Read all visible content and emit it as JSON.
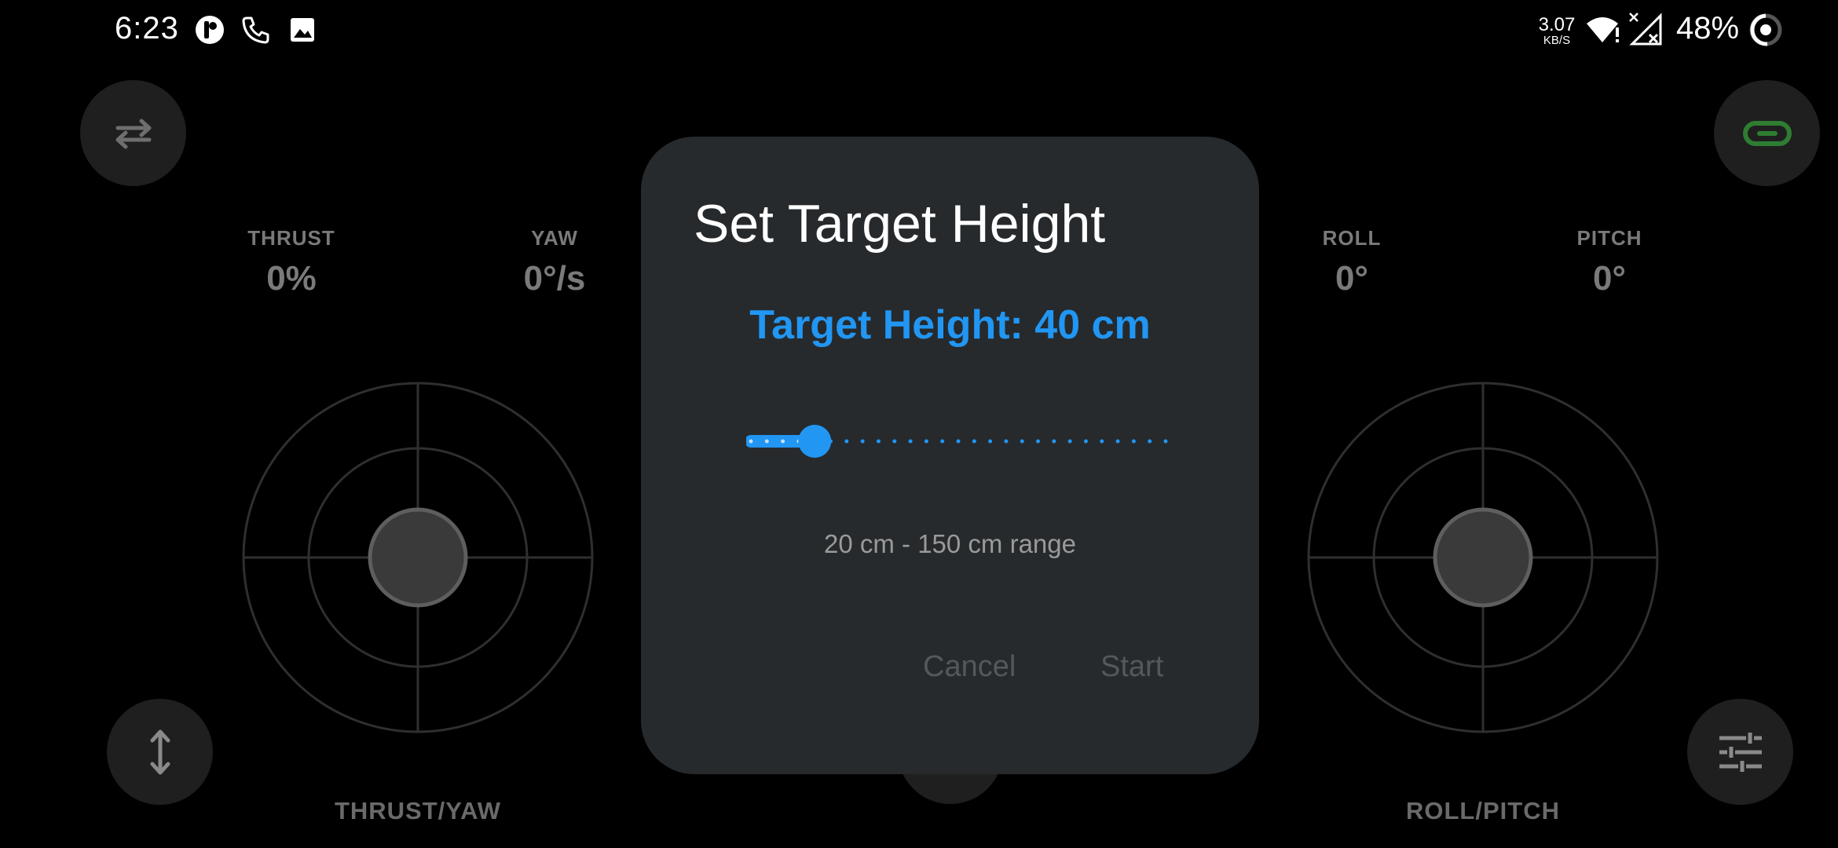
{
  "status_bar": {
    "time": "6:23",
    "net_speed_value": "3.07",
    "net_speed_unit": "KB/S",
    "battery": "48%",
    "icons": [
      "p-icon",
      "phone-icon",
      "image-icon",
      "wifi-alert-icon",
      "signal-off-icon",
      "battery-ring-icon"
    ]
  },
  "telemetry": {
    "thrust_label": "THRUST",
    "thrust_value": "0%",
    "yaw_label": "YAW",
    "yaw_value": "0°/s",
    "roll_label": "ROLL",
    "roll_value": "0°",
    "pitch_label": "PITCH",
    "pitch_value": "0°"
  },
  "joysticks": {
    "left_label": "THRUST/YAW",
    "right_label": "ROLL/PITCH"
  },
  "buttons": {
    "swap_icon": "swap-arrows-icon",
    "link_icon": "link-icon",
    "height_icon": "vertical-arrows-icon",
    "settings_icon": "sliders-icon"
  },
  "colors": {
    "accent": "#2196f3",
    "link_green": "#2e7d32",
    "dialog_bg": "#262a2d"
  },
  "dialog": {
    "title": "Set Target Height",
    "target_text": "Target Height: 40 cm",
    "slider": {
      "min": 20,
      "max": 150,
      "value": 40,
      "step": 5,
      "unit": "cm"
    },
    "range_text": "20 cm - 150 cm range",
    "cancel_label": "Cancel",
    "start_label": "Start"
  }
}
